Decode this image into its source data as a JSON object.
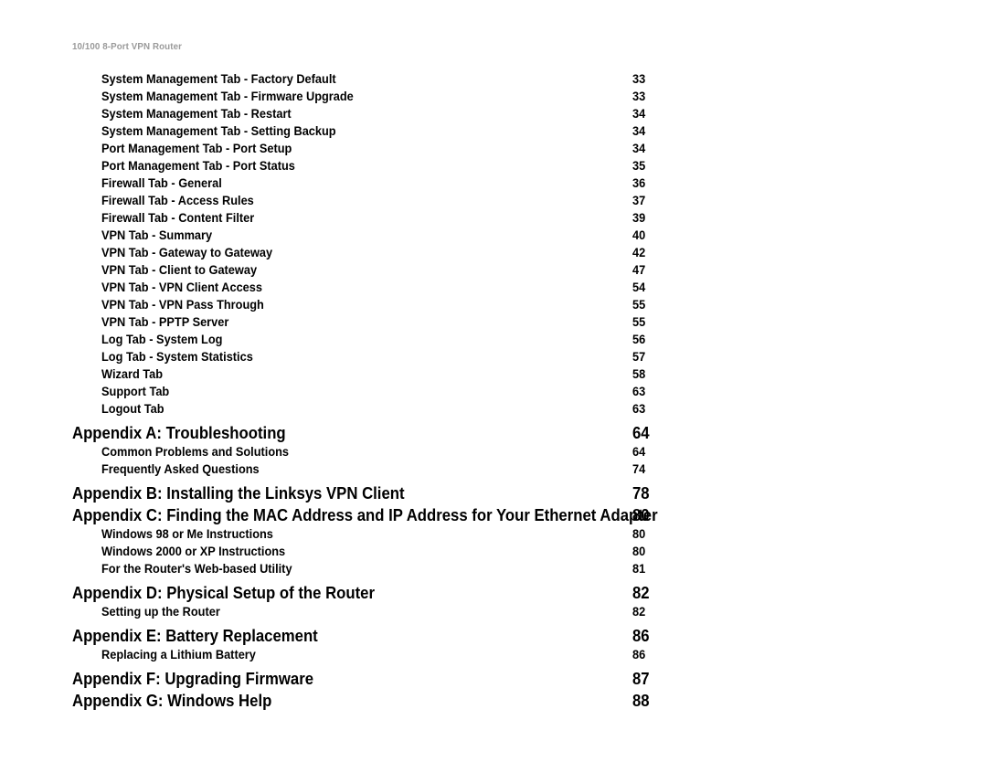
{
  "header": {
    "running_title": "10/100 8-Port VPN Router"
  },
  "toc": {
    "entries": [
      {
        "level": 2,
        "title": "System Management Tab - Factory Default",
        "page": "33"
      },
      {
        "level": 2,
        "title": "System Management Tab - Firmware Upgrade",
        "page": "33"
      },
      {
        "level": 2,
        "title": "System Management Tab - Restart",
        "page": "34"
      },
      {
        "level": 2,
        "title": "System Management Tab - Setting Backup",
        "page": "34"
      },
      {
        "level": 2,
        "title": "Port Management Tab - Port Setup",
        "page": "34"
      },
      {
        "level": 2,
        "title": "Port Management Tab - Port Status",
        "page": "35"
      },
      {
        "level": 2,
        "title": "Firewall Tab - General",
        "page": "36"
      },
      {
        "level": 2,
        "title": "Firewall Tab - Access Rules",
        "page": "37"
      },
      {
        "level": 2,
        "title": "Firewall Tab - Content Filter",
        "page": "39"
      },
      {
        "level": 2,
        "title": "VPN Tab - Summary",
        "page": "40"
      },
      {
        "level": 2,
        "title": "VPN Tab - Gateway to Gateway",
        "page": "42"
      },
      {
        "level": 2,
        "title": "VPN Tab - Client to Gateway",
        "page": "47"
      },
      {
        "level": 2,
        "title": "VPN Tab - VPN Client Access",
        "page": "54"
      },
      {
        "level": 2,
        "title": "VPN Tab - VPN Pass Through",
        "page": "55"
      },
      {
        "level": 2,
        "title": "VPN Tab - PPTP Server",
        "page": "55"
      },
      {
        "level": 2,
        "title": "Log Tab - System Log",
        "page": "56"
      },
      {
        "level": 2,
        "title": "Log Tab - System Statistics",
        "page": "57"
      },
      {
        "level": 2,
        "title": "Wizard Tab",
        "page": "58"
      },
      {
        "level": 2,
        "title": "Support Tab",
        "page": "63"
      },
      {
        "level": 2,
        "title": "Logout Tab",
        "page": "63"
      },
      {
        "level": 1,
        "title": "Appendix A: Troubleshooting",
        "page": "64"
      },
      {
        "level": 2,
        "title": "Common Problems and Solutions",
        "page": "64"
      },
      {
        "level": 2,
        "title": "Frequently Asked Questions",
        "page": "74"
      },
      {
        "level": 1,
        "title": "Appendix B: Installing the Linksys VPN Client",
        "page": "78"
      },
      {
        "level": 1,
        "title": "Appendix C: Finding the MAC Address and IP Address for Your Ethernet Adapter",
        "page": "80"
      },
      {
        "level": 2,
        "title": "Windows 98 or Me Instructions",
        "page": "80"
      },
      {
        "level": 2,
        "title": "Windows 2000 or XP Instructions",
        "page": "80"
      },
      {
        "level": 2,
        "title": "For the Router's Web-based Utility",
        "page": "81"
      },
      {
        "level": 1,
        "title": "Appendix D: Physical Setup of the Router",
        "page": "82"
      },
      {
        "level": 2,
        "title": "Setting up the Router",
        "page": "82"
      },
      {
        "level": 1,
        "title": "Appendix E: Battery Replacement",
        "page": "86"
      },
      {
        "level": 2,
        "title": "Replacing a Lithium Battery",
        "page": "86"
      },
      {
        "level": 1,
        "title": "Appendix F: Upgrading Firmware",
        "page": "87"
      },
      {
        "level": 1,
        "title": "Appendix G: Windows Help",
        "page": "88"
      }
    ]
  },
  "colors": {
    "page_background": "#ffffff",
    "text": "#000000",
    "running_header": "#9a9a9a"
  }
}
